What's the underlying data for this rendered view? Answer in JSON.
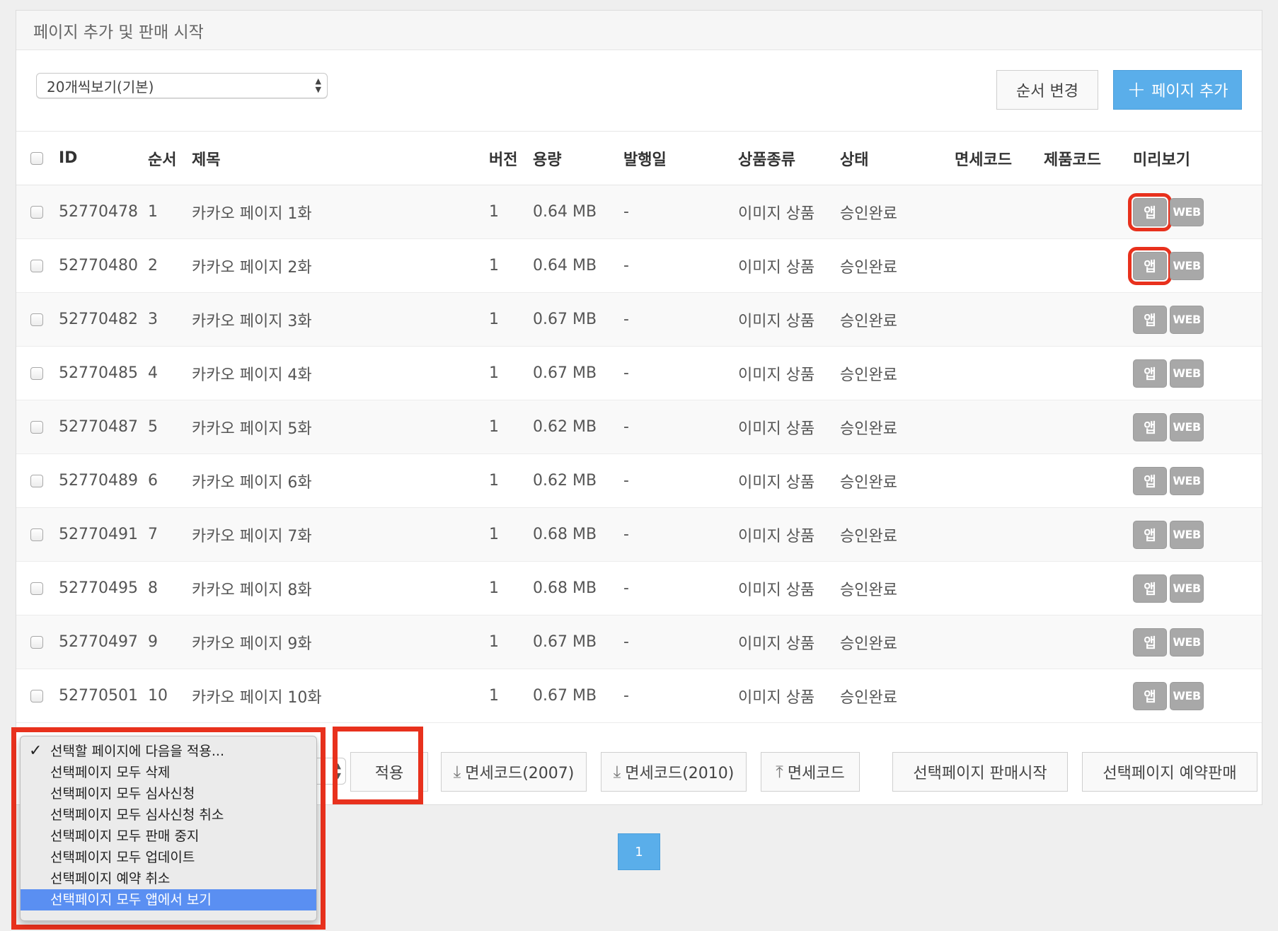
{
  "panel": {
    "title": "페이지 추가 및 판매 시작"
  },
  "toolbar": {
    "per_page": "20개씩보기(기본)",
    "order_btn": "순서 변경",
    "add_btn": "페이지 추가"
  },
  "table": {
    "headers": [
      "ID",
      "순서",
      "제목",
      "버전",
      "용량",
      "발행일",
      "상품종류",
      "상태",
      "면세코드",
      "제품코드",
      "미리보기"
    ],
    "preview_app": "앱",
    "preview_web": "WEB",
    "rows": [
      {
        "id": "52770478",
        "order": "1",
        "title": "카카오 페이지 1화",
        "version": "1",
        "size": "0.64 MB",
        "date": "-",
        "type": "이미지 상품",
        "status": "승인완료"
      },
      {
        "id": "52770480",
        "order": "2",
        "title": "카카오 페이지 2화",
        "version": "1",
        "size": "0.64 MB",
        "date": "-",
        "type": "이미지 상품",
        "status": "승인완료"
      },
      {
        "id": "52770482",
        "order": "3",
        "title": "카카오 페이지 3화",
        "version": "1",
        "size": "0.67 MB",
        "date": "-",
        "type": "이미지 상품",
        "status": "승인완료"
      },
      {
        "id": "52770485",
        "order": "4",
        "title": "카카오 페이지 4화",
        "version": "1",
        "size": "0.67 MB",
        "date": "-",
        "type": "이미지 상품",
        "status": "승인완료"
      },
      {
        "id": "52770487",
        "order": "5",
        "title": "카카오 페이지 5화",
        "version": "1",
        "size": "0.62 MB",
        "date": "-",
        "type": "이미지 상품",
        "status": "승인완료"
      },
      {
        "id": "52770489",
        "order": "6",
        "title": "카카오 페이지 6화",
        "version": "1",
        "size": "0.62 MB",
        "date": "-",
        "type": "이미지 상품",
        "status": "승인완료"
      },
      {
        "id": "52770491",
        "order": "7",
        "title": "카카오 페이지 7화",
        "version": "1",
        "size": "0.68 MB",
        "date": "-",
        "type": "이미지 상품",
        "status": "승인완료"
      },
      {
        "id": "52770495",
        "order": "8",
        "title": "카카오 페이지 8화",
        "version": "1",
        "size": "0.68 MB",
        "date": "-",
        "type": "이미지 상품",
        "status": "승인완료"
      },
      {
        "id": "52770497",
        "order": "9",
        "title": "카카오 페이지 9화",
        "version": "1",
        "size": "0.67 MB",
        "date": "-",
        "type": "이미지 상품",
        "status": "승인완료"
      },
      {
        "id": "52770501",
        "order": "10",
        "title": "카카오 페이지 10화",
        "version": "1",
        "size": "0.67 MB",
        "date": "-",
        "type": "이미지 상품",
        "status": "승인완료"
      }
    ]
  },
  "actions": {
    "apply": "적용",
    "dl_2007": "면세코드(2007)",
    "dl_2010": "면세코드(2010)",
    "upload": "면세코드",
    "sale_start": "선택페이지 판매시작",
    "reserve": "선택페이지 예약판매"
  },
  "dropdown": {
    "options": [
      "선택할 페이지에 다음을 적용...",
      "선택페이지 모두 삭제",
      "선택페이지 모두 심사신청",
      "선택페이지 모두 심사신청 취소",
      "선택페이지 모두 판매 중지",
      "선택페이지 모두 업데이트",
      "선택페이지 예약 취소",
      "선택페이지 모두 앱에서 보기"
    ],
    "checked_index": 0,
    "highlighted_index": 7
  },
  "pagination": {
    "current": "1"
  },
  "colors": {
    "accent": "#5aaeea",
    "highlight_box": "#e8311d",
    "menu_selection": "#5a8ff2"
  }
}
